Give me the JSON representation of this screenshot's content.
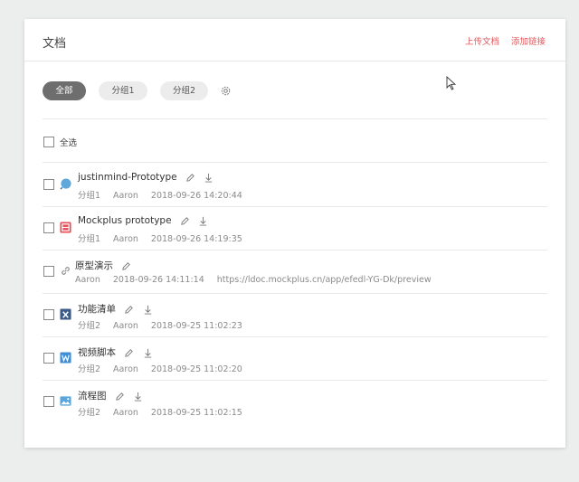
{
  "header": {
    "title": "文档",
    "upload_label": "上传文档",
    "add_link_label": "添加链接"
  },
  "tabs": [
    {
      "label": "全部",
      "active": true
    },
    {
      "label": "分组1",
      "active": false
    },
    {
      "label": "分组2",
      "active": false
    }
  ],
  "select_all_label": "全选",
  "files": [
    {
      "name": "justinmind-Prototype",
      "group": "分组1",
      "owner": "Aaron",
      "time": "2018-09-26 14:20:44",
      "icon": "justinmind-icon",
      "color": "#5b9bd5",
      "downloadable": true
    },
    {
      "name": "Mockplus prototype",
      "group": "分组1",
      "owner": "Aaron",
      "time": "2018-09-26 14:19:35",
      "icon": "mockplus-icon",
      "color": "#e54d58",
      "downloadable": true
    },
    {
      "name": "原型演示",
      "group": "",
      "owner": "Aaron",
      "time": "2018-09-26 14:11:14",
      "url": "https://ldoc.mockplus.cn/app/efedl-YG-Dk/preview",
      "icon": "link-icon",
      "color": "#999999",
      "downloadable": false
    },
    {
      "name": "功能清单",
      "group": "分组2",
      "owner": "Aaron",
      "time": "2018-09-25 11:02:23",
      "icon": "excel-icon",
      "color": "#3b5a8a",
      "downloadable": true
    },
    {
      "name": "视频脚本",
      "group": "分组2",
      "owner": "Aaron",
      "time": "2018-09-25 11:02:20",
      "icon": "word-icon",
      "color": "#3f8fd8",
      "downloadable": true
    },
    {
      "name": "流程图",
      "group": "分组2",
      "owner": "Aaron",
      "time": "2018-09-25 11:02:15",
      "icon": "image-icon",
      "color": "#58a6dc",
      "downloadable": true
    }
  ]
}
